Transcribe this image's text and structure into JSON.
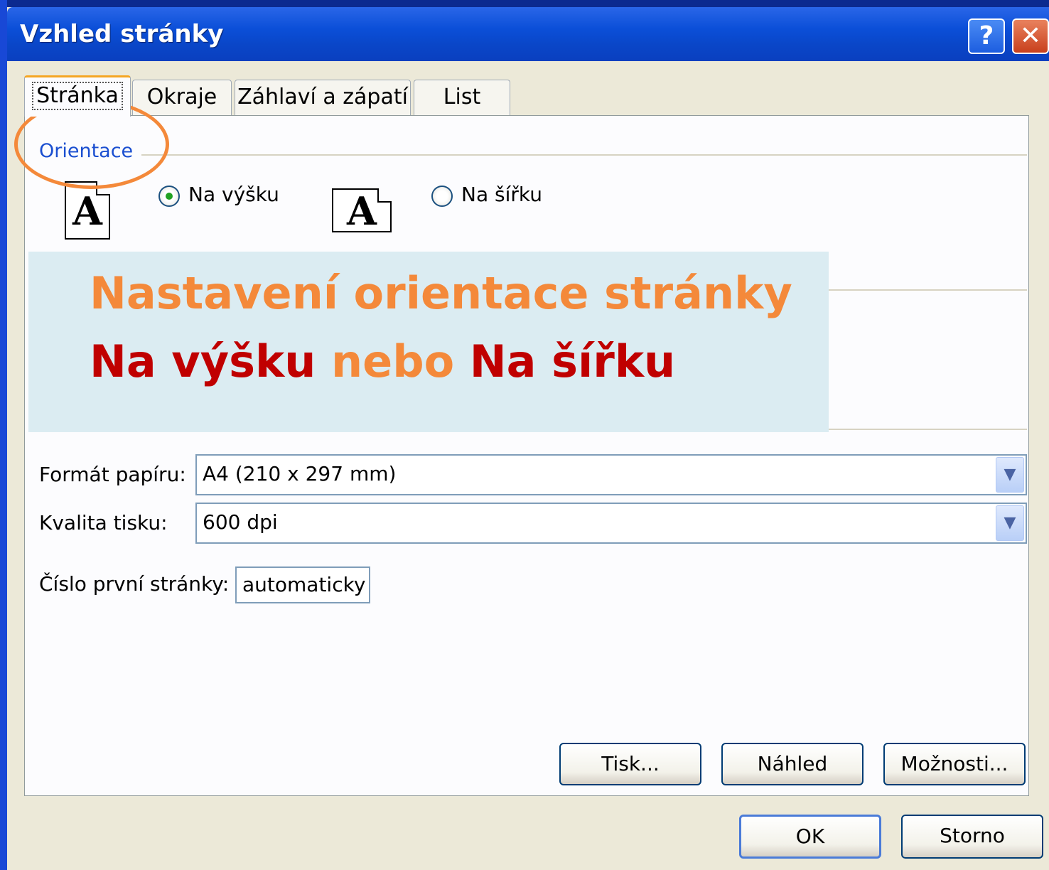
{
  "window": {
    "title": "Vzhled stránky",
    "help_glyph": "?",
    "close_glyph": "✕"
  },
  "tabs": [
    {
      "label": "Stránka",
      "active": true
    },
    {
      "label": "Okraje",
      "active": false
    },
    {
      "label": "Záhlaví a zápatí",
      "active": false
    },
    {
      "label": "List",
      "active": false
    }
  ],
  "orientation": {
    "group_label": "Orientace",
    "icon_letter": "A",
    "portrait_label": "Na výšku",
    "portrait_selected": true,
    "landscape_label": "Na šířku",
    "landscape_selected": false
  },
  "overlay": {
    "line1": "Nastavení orientace stránky",
    "line2_part1": "Na výšku",
    "line2_part2": "nebo",
    "line2_part3": "Na šířku"
  },
  "paper": {
    "format_label": "Formát papíru:",
    "format_value": "A4 (210 x 297 mm)",
    "quality_label": "Kvalita tisku:",
    "quality_value": "600 dpi",
    "first_page_label": "Číslo první stránky:",
    "first_page_value": "automaticky"
  },
  "panel_buttons": {
    "print": "Tisk...",
    "preview": "Náhled",
    "options": "Možnosti..."
  },
  "dialog_buttons": {
    "ok": "OK",
    "cancel": "Storno"
  },
  "colors": {
    "accent_orange": "#f4893a",
    "accent_red": "#c00000",
    "titlebar_blue": "#0b4fd8",
    "overlay_bg": "#dbecf2"
  },
  "icons": {
    "help": "question-mark-icon",
    "close": "close-icon",
    "dropdown": "chevron-down-icon"
  }
}
